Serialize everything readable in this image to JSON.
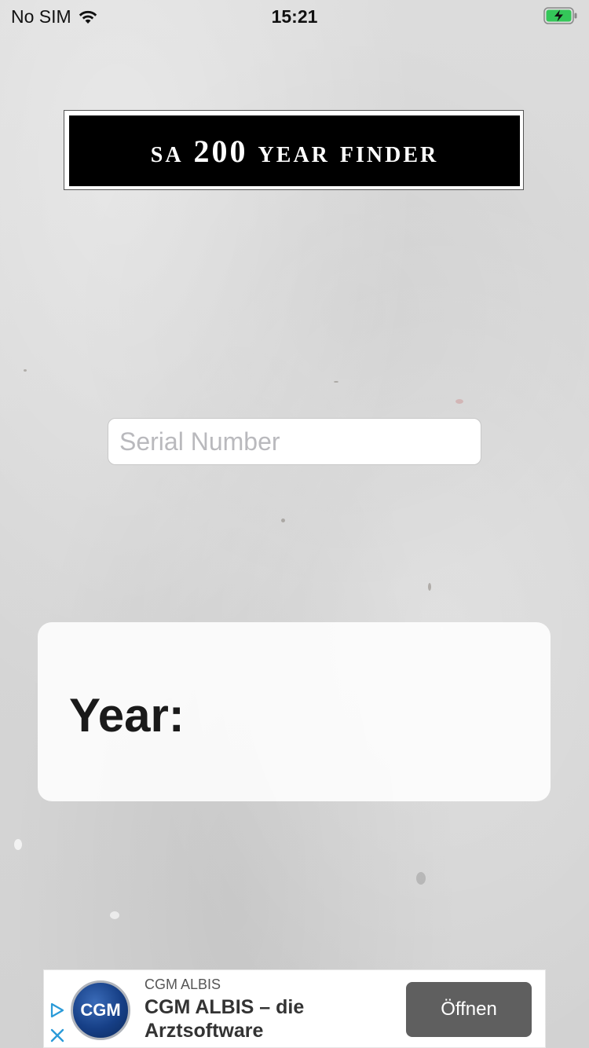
{
  "status_bar": {
    "carrier": "No SIM",
    "time": "15:21",
    "battery_color": "#34c759"
  },
  "header": {
    "title": "sa 200 year finder"
  },
  "form": {
    "serial_placeholder": "Serial Number",
    "serial_value": ""
  },
  "result": {
    "label": "Year:",
    "value": ""
  },
  "ad": {
    "advertiser": "CGM ALBIS",
    "headline": "CGM ALBIS – die Arztsoftware",
    "logo_text": "CGM",
    "cta_label": "Öffnen",
    "icons": [
      "ad-choices-icon",
      "close-icon"
    ]
  }
}
